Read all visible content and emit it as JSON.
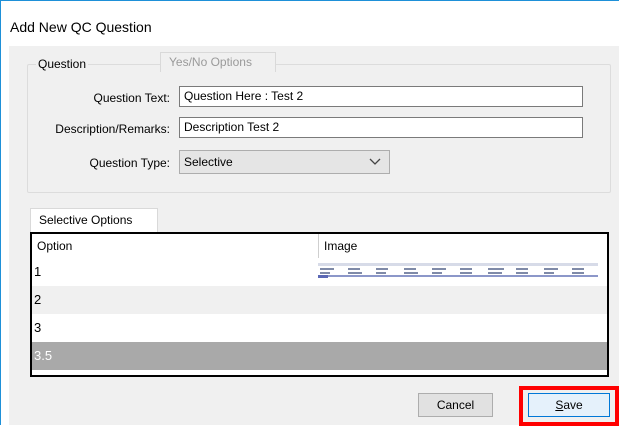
{
  "window": {
    "title": "Add New QC Question"
  },
  "question_group": {
    "legend": "Question",
    "question_text_label": "Question Text:",
    "question_text_value": "Question Here : Test 2",
    "description_label": "Description/Remarks:",
    "description_value": "Description Test 2",
    "question_type_label": "Question Type:",
    "question_type_value": "Selective"
  },
  "tabs": [
    {
      "label": "Selective Options",
      "active": true
    },
    {
      "label": "Yes/No Options",
      "active": false
    }
  ],
  "grid": {
    "columns": [
      "Option",
      "Image"
    ],
    "rows": [
      {
        "option": "1",
        "has_image": true,
        "background": "#ffffff",
        "text_color": "#000000"
      },
      {
        "option": "2",
        "has_image": false,
        "background": "#f0f0f0",
        "text_color": "#000000"
      },
      {
        "option": "3",
        "has_image": false,
        "background": "#ffffff",
        "text_color": "#000000"
      },
      {
        "option": "3.5",
        "has_image": false,
        "background": "#a9a9a9",
        "text_color": "#ffffff"
      }
    ]
  },
  "buttons": {
    "cancel_label": "Cancel",
    "save_accel": "S",
    "save_rest": "ave"
  },
  "colors": {
    "window_border": "#1e90d8",
    "highlight": "#ff0000",
    "selected_row": "#a9a9a9"
  },
  "icons": {
    "combo_arrow": "chevron-down-icon",
    "thumbnail": "image-thumbnail"
  }
}
